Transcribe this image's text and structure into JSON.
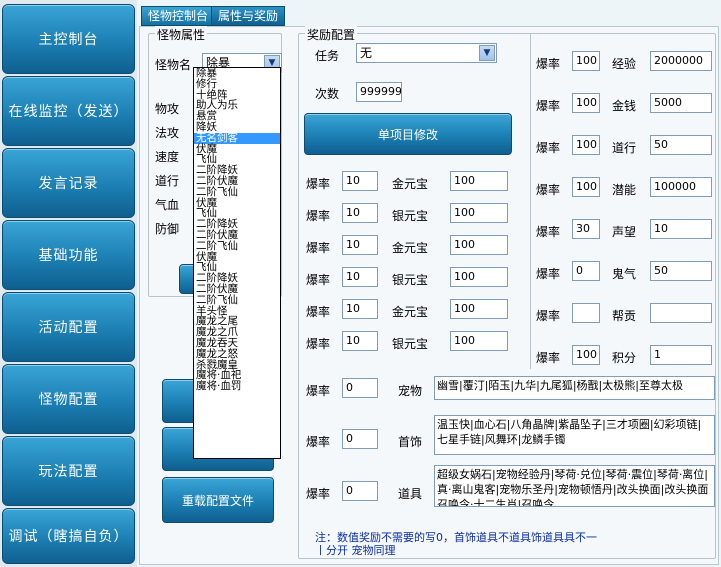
{
  "nav": {
    "items": [
      {
        "label": "主控制台"
      },
      {
        "label": "在线监控（发送）"
      },
      {
        "label": "发言记录"
      },
      {
        "label": "基础功能"
      },
      {
        "label": "活动配置"
      },
      {
        "label": "怪物配置"
      },
      {
        "label": "玩法配置"
      },
      {
        "label": "调试（瞎搞自负）"
      }
    ]
  },
  "tabs": [
    {
      "label": "怪物控制台"
    },
    {
      "label": "属性与奖励"
    }
  ],
  "monster": {
    "group_title": "怪物属性",
    "name_label": "怪物名",
    "name_value": "除暴",
    "attr_labels": [
      "物攻",
      "法攻",
      "速度",
      "道行",
      "气血",
      "防御"
    ],
    "dropdown_items": [
      "除暴",
      "修行",
      "十绝阵",
      "助人为乐",
      "悬赏",
      "降妖",
      "无名剑客",
      "伏魔",
      "飞仙",
      "二阶降妖",
      "二阶伏魔",
      "二阶飞仙",
      "伏魔",
      "飞仙",
      "二阶降妖",
      "二阶伏魔",
      "二阶飞仙",
      "伏魔",
      "飞仙",
      "二阶降妖",
      "二阶伏魔",
      "二阶飞仙",
      "羊头怪",
      "魔龙之尾",
      "魔龙之爪",
      "魔龙吞天",
      "魔龙之怒",
      "杀戮魔皇",
      "魔将·血祀",
      "魔将·血罚"
    ],
    "dropdown_selected": 6
  },
  "reload_button": "重载配置文件",
  "reward": {
    "group_title": "奖励配置",
    "task_label": "任务",
    "task_value": "无",
    "count_label": "次数",
    "count_value": "999999",
    "modify_button": "单项目修改",
    "left_rows": [
      {
        "rate_label": "爆率",
        "rate": "10",
        "item_label": "金元宝",
        "item_value": "100"
      },
      {
        "rate_label": "爆率",
        "rate": "10",
        "item_label": "银元宝",
        "item_value": "100"
      },
      {
        "rate_label": "爆率",
        "rate": "10",
        "item_label": "金元宝",
        "item_value": "100"
      },
      {
        "rate_label": "爆率",
        "rate": "10",
        "item_label": "银元宝",
        "item_value": "100"
      },
      {
        "rate_label": "爆率",
        "rate": "10",
        "item_label": "金元宝",
        "item_value": "100"
      },
      {
        "rate_label": "爆率",
        "rate": "10",
        "item_label": "银元宝",
        "item_value": "100"
      }
    ],
    "right_rows": [
      {
        "rate_label": "爆率",
        "rate": "100",
        "item_label": "经验",
        "item_value": "2000000"
      },
      {
        "rate_label": "爆率",
        "rate": "100",
        "item_label": "金钱",
        "item_value": "5000"
      },
      {
        "rate_label": "爆率",
        "rate": "100",
        "item_label": "道行",
        "item_value": "50"
      },
      {
        "rate_label": "爆率",
        "rate": "100",
        "item_label": "潜能",
        "item_value": "100000"
      },
      {
        "rate_label": "爆率",
        "rate": "30",
        "item_label": "声望",
        "item_value": "10"
      },
      {
        "rate_label": "爆率",
        "rate": "0",
        "item_label": "鬼气",
        "item_value": "50"
      },
      {
        "rate_label": "爆率",
        "rate": "",
        "item_label": "帮贡",
        "item_value": ""
      },
      {
        "rate_label": "爆率",
        "rate": "100",
        "item_label": "积分",
        "item_value": "1"
      }
    ],
    "pet_row": {
      "rate_label": "爆率",
      "rate": "0",
      "item_label": "宠物",
      "text": "幽雪|覆汀|陌玉|九华|九尾狐|杨戬|太极熊|至尊太极"
    },
    "jewelry_row": {
      "rate_label": "爆率",
      "rate": "0",
      "item_label": "首饰",
      "text": "温玉快|血心石|八角晶牌|紫晶坠子|三才项圈|幻彩项链|七星手链|风舞环|龙鳞手镯"
    },
    "prop_row": {
      "rate_label": "爆率",
      "rate": "0",
      "item_label": "道具",
      "text": "超级女娲石|宠物经验丹|琴荷·兑位|琴荷·震位|琴荷·离位|真·离山鬼客|宠物乐圣丹|宠物顿悟丹|改头换面|改头换面召唤令·十二生肖|召唤令"
    },
    "note": "注：数值奖励不需要的写0，首饰道具不道具饰道具具不一",
    "note2": "丨分开     宠物同理"
  }
}
